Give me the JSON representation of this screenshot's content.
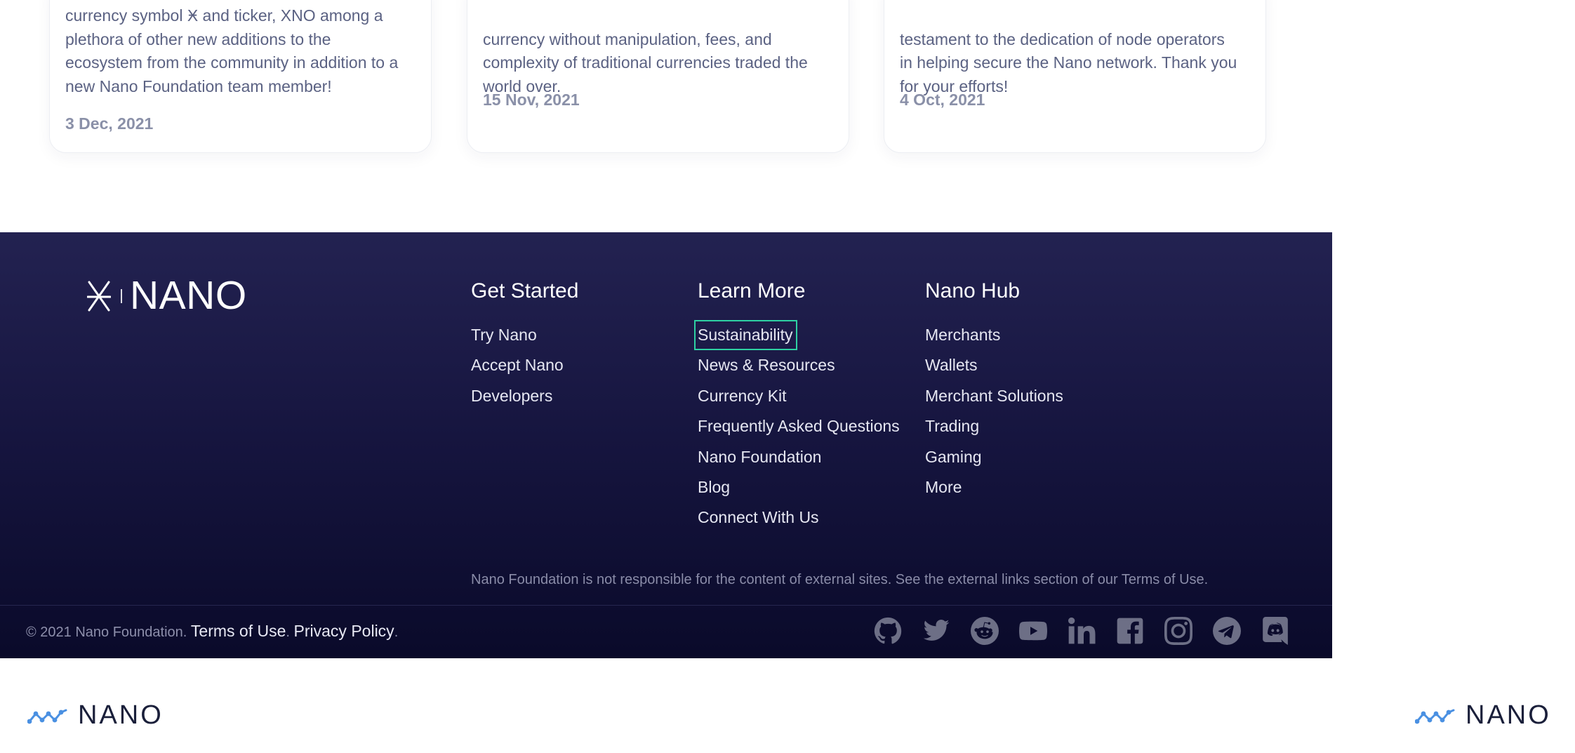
{
  "cards": [
    {
      "text": "currency symbol Ӿ and ticker, XNO among a\nplethora of other new additions to the\necosystem from the community in addition to a\nnew Nano Foundation team member!",
      "date": "3 Dec, 2021"
    },
    {
      "text": "currency without manipulation, fees, and\ncomplexity of traditional currencies traded the\nworld over.",
      "date": "15 Nov, 2021"
    },
    {
      "text": "testament to the dedication of node operators\nin helping secure the Nano network. Thank you\nfor your efforts!",
      "date": "4 Oct, 2021"
    }
  ],
  "footer": {
    "logo_text": "NANO",
    "columns": [
      {
        "title": "Get Started",
        "links": [
          "Try Nano",
          "Accept Nano",
          "Developers"
        ]
      },
      {
        "title": "Learn More",
        "links": [
          "Sustainability",
          "News & Resources",
          "Currency Kit",
          "Frequently Asked Questions",
          "Nano Foundation",
          "Blog",
          "Connect With Us"
        ]
      },
      {
        "title": "Nano Hub",
        "links": [
          "Merchants",
          "Wallets",
          "Merchant Solutions",
          "Trading",
          "Gaming",
          "More"
        ]
      }
    ],
    "disclaimer": "Nano Foundation is not responsible for the content of external sites. See the external links section of our Terms of Use.",
    "copyright": "© 2021 Nano Foundation.",
    "terms_label": "Terms of Use",
    "privacy_label": "Privacy Policy",
    "dot": ".",
    "social_icons": [
      "github-icon",
      "twitter-icon",
      "reddit-icon",
      "youtube-icon",
      "linkedin-icon",
      "facebook-icon",
      "instagram-icon",
      "telegram-icon",
      "discord-icon"
    ]
  },
  "bottom_logo_text": "NANO",
  "colors": {
    "focus_ring": "#2ed1a3",
    "footer_bg_top": "#232251",
    "footer_bg_bottom": "#0a0a2a",
    "logo_blue": "#4a90e2"
  }
}
